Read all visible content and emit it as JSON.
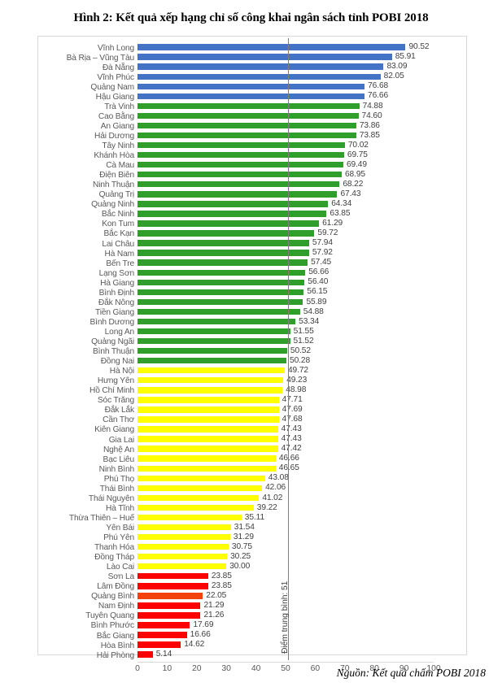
{
  "figure": {
    "title": "Hình 2: Kết quả xếp hạng chỉ số công khai ngân sách tỉnh POBI 2018",
    "source": "Nguồn: Kết quả chấm POBI 2018"
  },
  "annotations": {
    "average_label": "Điểm trung bình: 51",
    "average_value": 51
  },
  "colors": {
    "blue": "#4472C4",
    "green": "#2F9E2B",
    "yellow": "#FFFF00",
    "red": "#FF0000",
    "orange": "#F4420E",
    "axis_text": "#595959",
    "value_text": "#404040",
    "gridline": "#D9D9D9",
    "avg_line": "#7F7F7F"
  },
  "chart_data": {
    "type": "bar",
    "orientation": "horizontal",
    "title": "Hình 2: Kết quả xếp hạng chỉ số công khai ngân sách tỉnh POBI 2018",
    "xlabel": "",
    "ylabel": "",
    "xlim": [
      0,
      100
    ],
    "xticks": [
      0,
      10,
      20,
      30,
      40,
      50,
      60,
      70,
      80,
      90,
      100
    ],
    "grid": false,
    "legend": "none",
    "reference_line": {
      "x": 51,
      "label": "Điểm trung bình: 51"
    },
    "categories": [
      "Vĩnh Long",
      "Bà Rịa – Vũng Tàu",
      "Đà Nẵng",
      "Vĩnh Phúc",
      "Quảng Nam",
      "Hậu Giang",
      "Trà Vinh",
      "Cao Bằng",
      "An Giang",
      "Hải Dương",
      "Tây Ninh",
      "Khánh Hòa",
      "Cà Mau",
      "Điện Biên",
      "Ninh Thuận",
      "Quảng Trị",
      "Quảng Ninh",
      "Bắc Ninh",
      "Kon Tum",
      "Bắc Kạn",
      "Lai Châu",
      "Hà Nam",
      "Bến Tre",
      "Lạng Sơn",
      "Hà Giang",
      "Bình Định",
      "Đắk Nông",
      "Tiền Giang",
      "Bình Dương",
      "Long An",
      "Quảng Ngãi",
      "Bình Thuận",
      "Đồng Nai",
      "Hà Nội",
      "Hưng Yên",
      "Hồ Chí Minh",
      "Sóc Trăng",
      "Đắk Lắk",
      "Cần Thơ",
      "Kiên Giang",
      "Gia Lai",
      "Nghệ An",
      "Bạc Liêu",
      "Ninh Bình",
      "Phú Thọ",
      "Thái Bình",
      "Thái Nguyên",
      "Hà Tĩnh",
      "Thừa Thiên – Huế",
      "Yên Bái",
      "Phú Yên",
      "Thanh Hóa",
      "Đồng Tháp",
      "Lào Cai",
      "Sơn La",
      "Lâm Đồng",
      "Quảng Bình",
      "Nam Định",
      "Tuyên Quang",
      "Bình Phước",
      "Bắc Giang",
      "Hòa Bình",
      "Hải Phòng"
    ],
    "values": [
      90.52,
      85.91,
      83.09,
      82.05,
      76.68,
      76.66,
      74.88,
      74.6,
      73.86,
      73.85,
      70.02,
      69.75,
      69.49,
      68.95,
      68.22,
      67.43,
      64.34,
      63.85,
      61.29,
      59.72,
      57.94,
      57.92,
      57.45,
      56.66,
      56.4,
      56.15,
      55.89,
      54.88,
      53.34,
      51.55,
      51.52,
      50.52,
      50.28,
      49.72,
      49.23,
      48.98,
      47.71,
      47.69,
      47.68,
      47.43,
      47.43,
      47.42,
      46.66,
      46.65,
      43.08,
      42.06,
      41.02,
      39.22,
      35.11,
      31.54,
      31.29,
      30.75,
      30.25,
      30.0,
      23.85,
      23.85,
      22.05,
      21.29,
      21.26,
      17.69,
      16.66,
      14.62,
      5.14
    ],
    "value_labels": [
      "90.52",
      "85.91",
      "83.09",
      "82.05",
      "76.68",
      "76.66",
      "74.88",
      "74.60",
      "73.86",
      "73.85",
      "70.02",
      "69.75",
      "69.49",
      "68.95",
      "68.22",
      "67.43",
      "64.34",
      "63.85",
      "61.29",
      "59.72",
      "57.94",
      "57.92",
      "57.45",
      "56.66",
      "56.40",
      "56.15",
      "55.89",
      "54.88",
      "53.34",
      "51.55",
      "51.52",
      "50.52",
      "50.28",
      "49.72",
      "49.23",
      "48.98",
      "47.71",
      "47.69",
      "47.68",
      "47.43",
      "47.43",
      "47.42",
      "46.66",
      "46.65",
      "43.08",
      "42.06",
      "41.02",
      "39.22",
      "35.11",
      "31.54",
      "31.29",
      "30.75",
      "30.25",
      "30.00",
      "23.85",
      "23.85",
      "22.05",
      "21.29",
      "21.26",
      "17.69",
      "16.66",
      "14.62",
      "5.14"
    ],
    "bar_colors": [
      "#4472C4",
      "#4472C4",
      "#4472C4",
      "#4472C4",
      "#4472C4",
      "#4472C4",
      "#2F9E2B",
      "#2F9E2B",
      "#2F9E2B",
      "#2F9E2B",
      "#2F9E2B",
      "#2F9E2B",
      "#2F9E2B",
      "#2F9E2B",
      "#2F9E2B",
      "#2F9E2B",
      "#2F9E2B",
      "#2F9E2B",
      "#2F9E2B",
      "#2F9E2B",
      "#2F9E2B",
      "#2F9E2B",
      "#2F9E2B",
      "#2F9E2B",
      "#2F9E2B",
      "#2F9E2B",
      "#2F9E2B",
      "#2F9E2B",
      "#2F9E2B",
      "#2F9E2B",
      "#2F9E2B",
      "#2F9E2B",
      "#2F9E2B",
      "#FFFF00",
      "#FFFF00",
      "#FFFF00",
      "#FFFF00",
      "#FFFF00",
      "#FFFF00",
      "#FFFF00",
      "#FFFF00",
      "#FFFF00",
      "#FFFF00",
      "#FFFF00",
      "#FFFF00",
      "#FFFF00",
      "#FFFF00",
      "#FFFF00",
      "#FFFF00",
      "#FFFF00",
      "#FFFF00",
      "#FFFF00",
      "#FFFF00",
      "#FFFF00",
      "#FF0000",
      "#FF0000",
      "#F4420E",
      "#FF0000",
      "#FF0000",
      "#FF0000",
      "#FF0000",
      "#FF0000",
      "#FF0000"
    ]
  }
}
